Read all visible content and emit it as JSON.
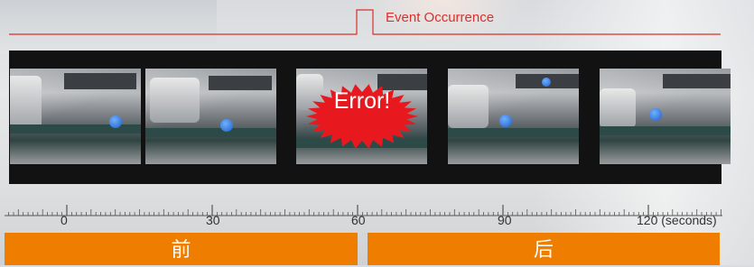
{
  "event": {
    "label": "Event Occurrence",
    "color": "#d9302c"
  },
  "frames": [
    {
      "id": "frame-1",
      "highlight": false
    },
    {
      "id": "frame-2",
      "highlight": false
    },
    {
      "id": "frame-3",
      "highlight": true,
      "label": "Error!",
      "burst_color": "#e8191e"
    },
    {
      "id": "frame-4",
      "highlight": false
    },
    {
      "id": "frame-5",
      "highlight": false
    }
  ],
  "timeline": {
    "ticks": [
      "0",
      "30",
      "60",
      "90",
      "120 (seconds)"
    ]
  },
  "sections": {
    "before": "前",
    "after": "后"
  },
  "colors": {
    "section_bar": "#ee7d00",
    "film_strip": "#121212",
    "marker_dot": "#1f5fc9"
  }
}
